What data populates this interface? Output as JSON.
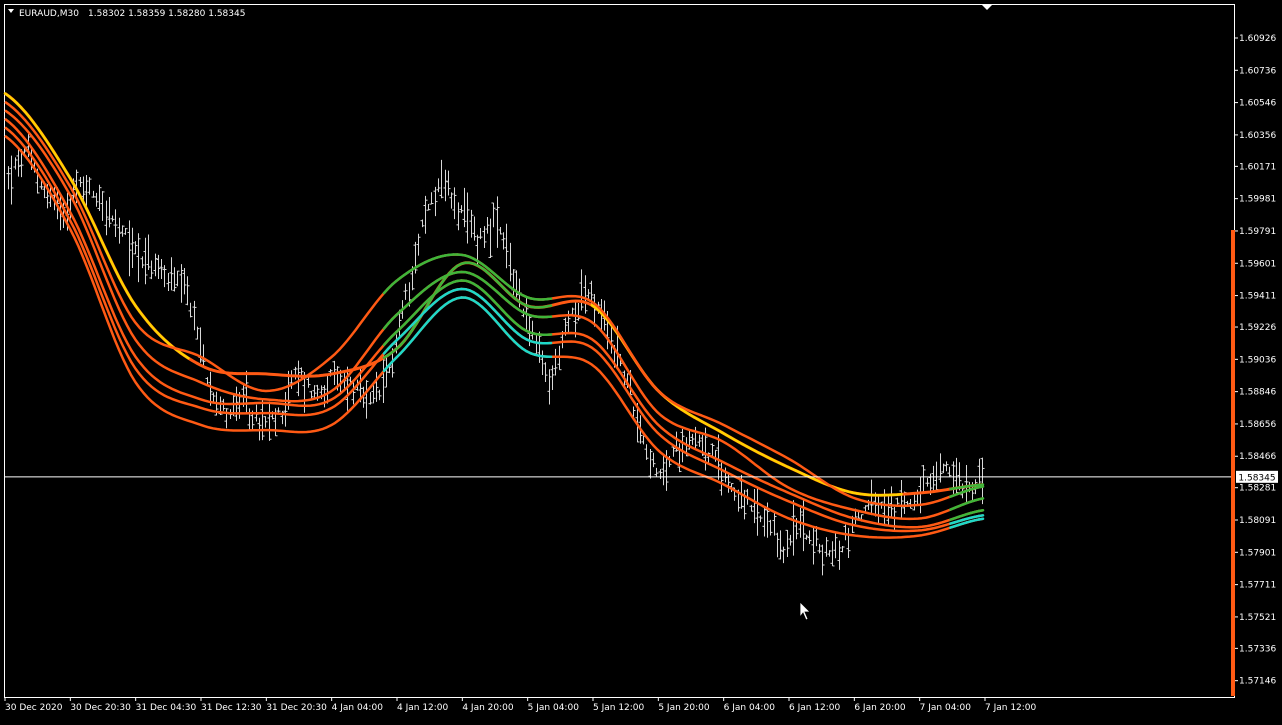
{
  "header": {
    "symbol": "EURAUD,M30",
    "ohlc": "1.58302 1.58359 1.58280 1.58345",
    "dropdown_icon": "triangle-down-icon"
  },
  "price_tag": {
    "value": "1.58345",
    "background": "#ffffff",
    "text": "#000000"
  },
  "colors": {
    "background": "#000000",
    "frame": "#ffffff",
    "candles": "#d8d8d8",
    "ma_orange": "#ff5a14",
    "ma_yellow": "#ffd000",
    "ma_green": "#3fb53a",
    "ma_cyan": "#1fd8c8",
    "scroll_marker": "#ff5a14",
    "current_price_line": "#ffffff"
  },
  "cursor_icon": "mouse-pointer-icon",
  "scroll_marker_icon": "shift-marker-icon",
  "chart_data": {
    "type": "line",
    "symbol": "EURAUD",
    "timeframe": "M30",
    "ylim": [
      1.5705,
      1.6112
    ],
    "current_price": 1.58345,
    "y_ticks": [
      "1.60926",
      "1.60736",
      "1.60546",
      "1.60356",
      "1.60171",
      "1.59981",
      "1.59791",
      "1.59601",
      "1.59411",
      "1.59226",
      "1.59036",
      "1.58846",
      "1.58656",
      "1.58466",
      "1.58281",
      "1.58091",
      "1.57901",
      "1.57711",
      "1.57521",
      "1.57336",
      "1.57146"
    ],
    "x_ticks": [
      "30 Dec 2020",
      "30 Dec 20:30",
      "31 Dec 04:30",
      "31 Dec 12:30",
      "31 Dec 20:30",
      "4 Jan 04:00",
      "4 Jan 12:00",
      "4 Jan 20:00",
      "5 Jan 04:00",
      "5 Jan 12:00",
      "5 Jan 20:00",
      "6 Jan 04:00",
      "6 Jan 12:00",
      "6 Jan 20:00",
      "7 Jan 04:00",
      "7 Jan 12:00"
    ],
    "price_path": [
      1.601,
      1.6025,
      1.6003,
      1.5992,
      1.6006,
      1.6,
      1.598,
      1.5969,
      1.5958,
      1.5951,
      1.594,
      1.5895,
      1.5872,
      1.5878,
      1.5863,
      1.587,
      1.5896,
      1.5883,
      1.5892,
      1.5889,
      1.5876,
      1.5891,
      1.5939,
      1.5985,
      1.601,
      1.599,
      1.5975,
      1.5985,
      1.5953,
      1.592,
      1.5887,
      1.5925,
      1.5945,
      1.5925,
      1.5901,
      1.5865,
      1.5832,
      1.585,
      1.586,
      1.5847,
      1.583,
      1.5818,
      1.5805,
      1.5792,
      1.5808,
      1.579,
      1.579,
      1.5811,
      1.5818,
      1.5813,
      1.5822,
      1.5828,
      1.584,
      1.583,
      1.5834
    ],
    "series": [
      {
        "values": [
          1.606,
          1.601,
          1.5935,
          1.59,
          1.5895,
          1.5895,
          1.591,
          1.596,
          1.5935,
          1.5935,
          1.5885,
          1.586,
          1.584,
          1.5825,
          1.5825,
          1.583
        ]
      },
      {
        "values": [
          1.6055,
          1.6005,
          1.5925,
          1.5905,
          1.5885,
          1.5905,
          1.595,
          1.5965,
          1.594,
          1.5937,
          1.5885,
          1.5865,
          1.5845,
          1.5822,
          1.5818,
          1.5829
        ]
      },
      {
        "values": [
          1.605,
          1.6,
          1.5915,
          1.589,
          1.588,
          1.5885,
          1.593,
          1.5955,
          1.593,
          1.5925,
          1.5872,
          1.5855,
          1.5828,
          1.5815,
          1.581,
          1.5822
        ]
      },
      {
        "values": [
          1.6045,
          1.599,
          1.5905,
          1.588,
          1.5878,
          1.588,
          1.592,
          1.595,
          1.592,
          1.5915,
          1.5865,
          1.5843,
          1.5825,
          1.581,
          1.5805,
          1.5815
        ]
      },
      {
        "values": [
          1.604,
          1.5985,
          1.5898,
          1.5875,
          1.5872,
          1.5875,
          1.5915,
          1.5945,
          1.5915,
          1.591,
          1.586,
          1.5838,
          1.582,
          1.5806,
          1.5803,
          1.5812
        ]
      },
      {
        "values": [
          1.6035,
          1.598,
          1.589,
          1.5865,
          1.5862,
          1.5865,
          1.5905,
          1.594,
          1.5908,
          1.59,
          1.585,
          1.583,
          1.581,
          1.58,
          1.58,
          1.581
        ]
      }
    ]
  }
}
